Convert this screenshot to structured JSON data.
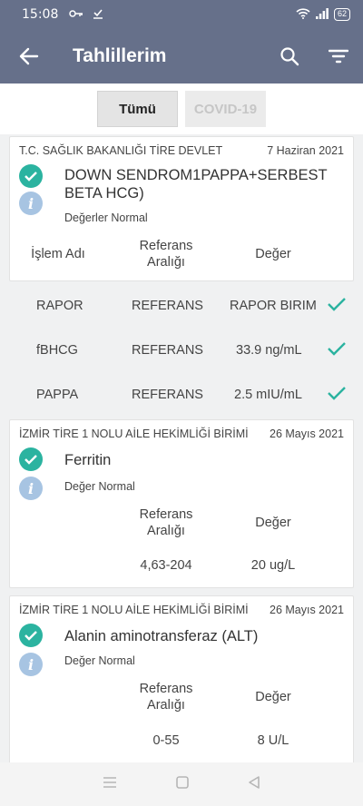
{
  "status_bar": {
    "time": "15:08",
    "battery": "62"
  },
  "app_bar": {
    "title": "Tahlillerim"
  },
  "segments": [
    {
      "label": "Tümü",
      "active": true
    },
    {
      "label": "COVID-19",
      "active": false
    }
  ],
  "cards": [
    {
      "institution": "T.C. SAĞLIK BAKANLIĞI TİRE DEVLET",
      "date": "7 Haziran 2021",
      "test_name": "DOWN SENDROM1PAPPA+SERBEST BETA HCG)",
      "status": "Değerler Normal",
      "col_name": "İşlem Adı",
      "col_range": "Referans Aralığı",
      "col_value": "Değer"
    },
    {
      "institution": "İZMİR TİRE 1 NOLU AİLE HEKİMLİĞİ BİRİMİ",
      "date": "26 Mayıs 2021",
      "test_name": "Ferritin",
      "status": "Değer Normal",
      "col_range": "Referans Aralığı",
      "col_value": "Değer",
      "range": "4,63-204",
      "value": "20 ug/L"
    },
    {
      "institution": "İZMİR TİRE 1 NOLU AİLE HEKİMLİĞİ BİRİMİ",
      "date": "26 Mayıs 2021",
      "test_name": "Alanin aminotransferaz (ALT)",
      "status": "Değer Normal",
      "col_range": "Referans Aralığı",
      "col_value": "Değer",
      "range": "0-55",
      "value": "8 U/L"
    }
  ],
  "sub_results": [
    {
      "name": "RAPOR",
      "reference": "REFERANS",
      "value": "RAPOR BIRIM"
    },
    {
      "name": "fBHCG",
      "reference": "REFERANS",
      "value": "33.9 ng/mL"
    },
    {
      "name": "PAPPA",
      "reference": "REFERANS",
      "value": "2.5 mIU/mL"
    }
  ],
  "colors": {
    "header": "#66708a",
    "check": "#2bb3a0",
    "info": "#a7c4e2"
  }
}
